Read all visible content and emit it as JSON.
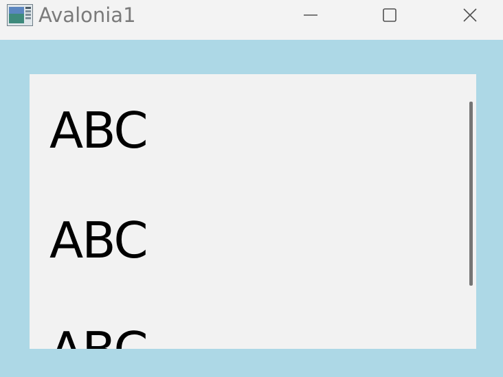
{
  "window": {
    "title": "Avalonia1",
    "app_icon": "avalonia-app-icon",
    "controls": {
      "minimize_icon": "minimize-icon",
      "maximize_icon": "maximize-icon",
      "close_icon": "close-icon"
    }
  },
  "colors": {
    "titlebar_bg": "#f3f3f3",
    "title_text": "#7a7a7a",
    "window_bg": "#add8e6",
    "listbox_bg": "#f2f2f2",
    "item_text": "#000000",
    "scrollbar_thumb": "#757575"
  },
  "listbox": {
    "items": [
      {
        "label": "ABC"
      },
      {
        "label": "ABC"
      },
      {
        "label": "ABC"
      }
    ]
  }
}
